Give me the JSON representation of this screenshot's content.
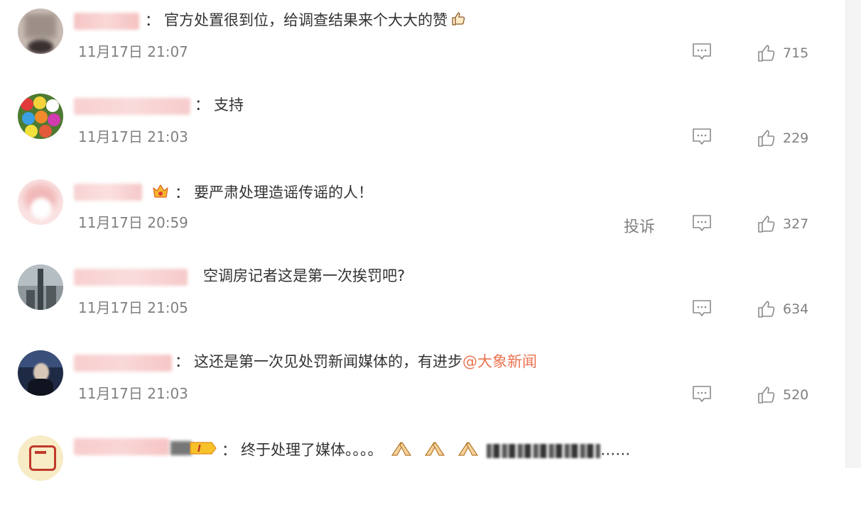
{
  "comments": [
    {
      "text": "官方处置很到位，给调查结果来个大大的赞",
      "time": "11月17日 21:07",
      "likes": "715",
      "avatar_color": "#b8a8a0"
    },
    {
      "text": "支持",
      "time": "11月17日 21:03",
      "likes": "229",
      "avatar_color": "#5a8a3c"
    },
    {
      "text": "要严肃处理造谣传谣的人！",
      "time": "11月17日 20:59",
      "likes": "327",
      "report": "投诉",
      "avatar_color": "#f2c7c7"
    },
    {
      "text": "空调房记者这是第一次挨罚吧?",
      "time": "11月17日 21:05",
      "likes": "634",
      "avatar_color": "#6a7478"
    },
    {
      "text": "这还是第一次见处罚新闻媒体的，有进步",
      "mention": "@大象新闻",
      "time": "11月17日 21:03",
      "likes": "520",
      "avatar_color": "#2a3550"
    },
    {
      "text": "终于处理了媒体。。。。",
      "trailing": "……",
      "avatar_color": "#f5e6b0"
    }
  ],
  "colors": {
    "mention": "#eb7350",
    "meta": "#808080",
    "text": "#333333"
  },
  "icons": {
    "reply": "comment-reply-icon",
    "like": "thumbs-up-icon",
    "vip": "vip-crown-icon",
    "clap": "praying-hands-emoji"
  }
}
